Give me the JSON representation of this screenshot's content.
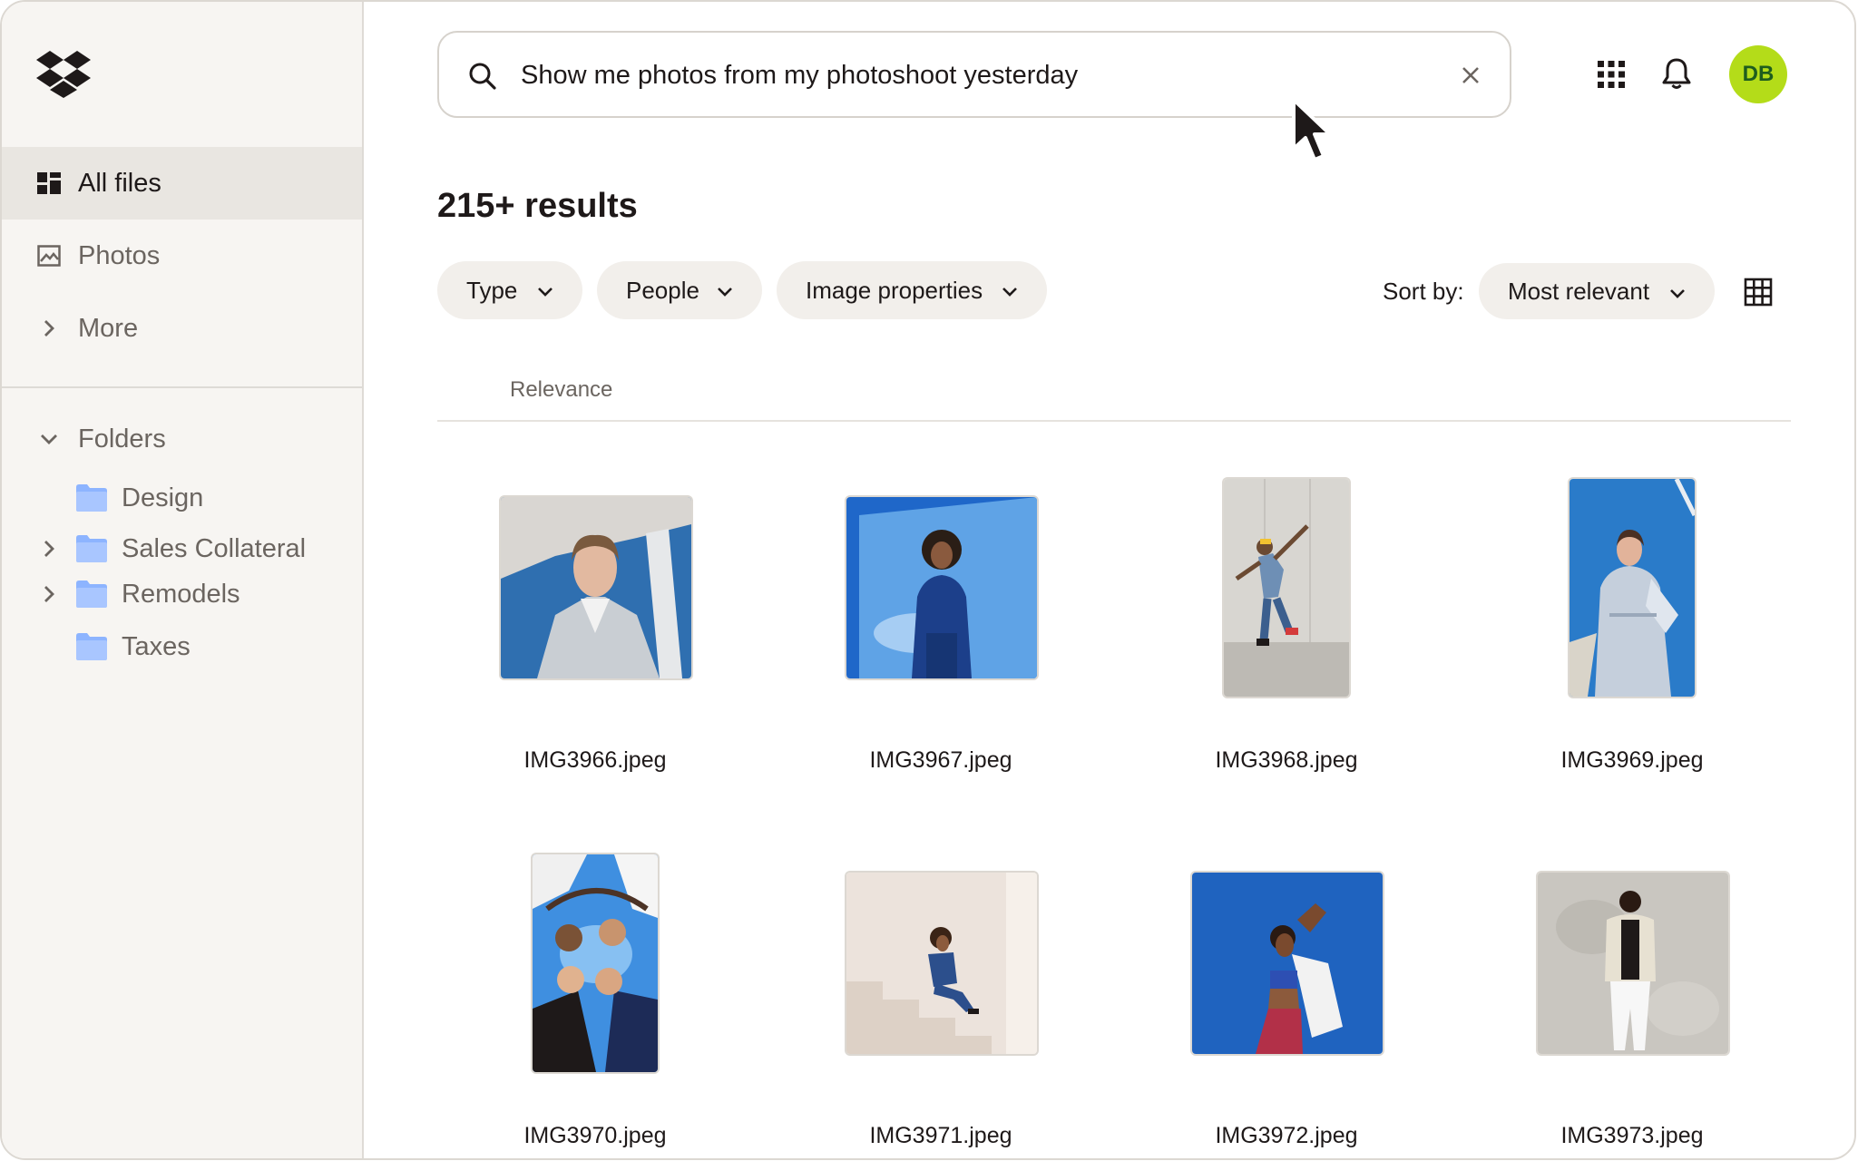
{
  "sidebar": {
    "logo_icon": "dropbox-logo",
    "nav": [
      {
        "label": "All files",
        "icon": "all-files-icon",
        "active": true
      },
      {
        "label": "Photos",
        "icon": "photo-icon",
        "active": false
      },
      {
        "label": "More",
        "icon": "chevron-right-icon",
        "active": false
      }
    ],
    "folders_label": "Folders",
    "folders": [
      {
        "name": "Design",
        "expandable": false
      },
      {
        "name": "Sales Collateral",
        "expandable": true
      },
      {
        "name": "Remodels",
        "expandable": true
      },
      {
        "name": "Taxes",
        "expandable": false
      }
    ]
  },
  "header": {
    "search_value": "Show me photos from my photoshoot yesterday",
    "avatar_initials": "DB",
    "avatar_color": "#b4dc19"
  },
  "results": {
    "title": "215+ results",
    "filters": [
      "Type",
      "People",
      "Image properties"
    ],
    "sort_label": "Sort by:",
    "sort_value": "Most relevant",
    "column_header": "Relevance",
    "files": [
      "IMG3966.jpeg",
      "IMG3967.jpeg",
      "IMG3968.jpeg",
      "IMG3969.jpeg",
      "IMG3970.jpeg",
      "IMG3971.jpeg",
      "IMG3972.jpeg",
      "IMG3973.jpeg"
    ]
  },
  "colors": {
    "sidebar_bg": "#f7f5f2",
    "active_nav_bg": "#e9e6e1",
    "folder_blue": "#8db4ff",
    "chip_bg": "#f2efeb"
  }
}
